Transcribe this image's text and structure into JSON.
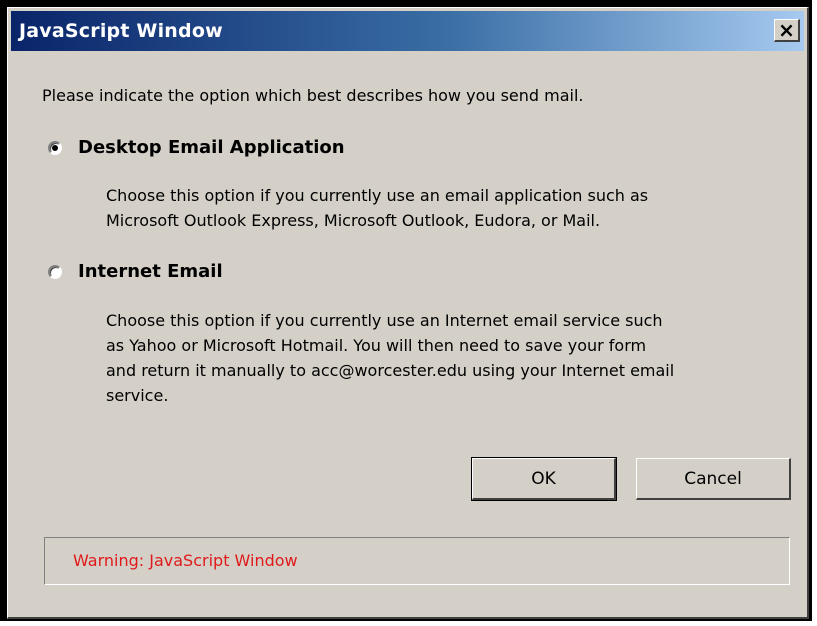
{
  "window": {
    "title": "JavaScript Window",
    "close_glyph": "✕"
  },
  "prompt": "Please indicate the option which best describes how you send mail.",
  "options": [
    {
      "label": "Desktop Email Application",
      "selected": true,
      "description_lines": [
        "Choose this option if you currently use an email application such as",
        "Microsoft Outlook Express, Microsoft Outlook, Eudora, or Mail."
      ]
    },
    {
      "label": "Internet Email",
      "selected": false,
      "description_lines": [
        "Choose this option if you currently use an Internet email service such",
        "as Yahoo or Microsoft Hotmail. You will then need to save your form",
        "and return it manually to acc@worcester.edu using your Internet email",
        "service."
      ]
    }
  ],
  "buttons": {
    "ok": "OK",
    "cancel": "Cancel"
  },
  "status": {
    "text": "Warning: JavaScript Window",
    "color": "#e0191b"
  },
  "colors": {
    "titlebar_start": "#0a246a",
    "dialog_bg": "#d4d0c8"
  }
}
